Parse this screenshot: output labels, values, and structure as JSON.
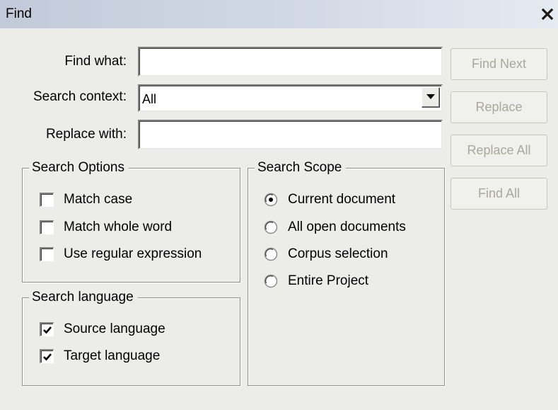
{
  "window": {
    "title": "Find",
    "close_icon": "close-icon"
  },
  "form": {
    "find_what_label": "Find what:",
    "find_what_value": "",
    "search_context_label": "Search context:",
    "search_context_value": "All",
    "replace_with_label": "Replace with:",
    "replace_with_value": ""
  },
  "buttons": {
    "find_next": "Find Next",
    "replace": "Replace",
    "replace_all": "Replace All",
    "find_all": "Find All",
    "enabled": false
  },
  "search_options": {
    "title": "Search Options",
    "items": [
      {
        "label": "Match case",
        "checked": false
      },
      {
        "label": "Match whole word",
        "checked": false
      },
      {
        "label": "Use regular expression",
        "checked": false
      }
    ]
  },
  "search_language": {
    "title": "Search language",
    "items": [
      {
        "label": "Source language",
        "checked": true
      },
      {
        "label": "Target language",
        "checked": true
      }
    ]
  },
  "search_scope": {
    "title": "Search Scope",
    "items": [
      {
        "label": "Current document",
        "selected": true
      },
      {
        "label": "All open documents",
        "selected": false
      },
      {
        "label": "Corpus selection",
        "selected": false
      },
      {
        "label": "Entire Project",
        "selected": false
      }
    ]
  },
  "colors": {
    "dialog_bg": "#ecece9",
    "title_gradient_start": "#c2cad9",
    "title_gradient_end": "#e6eaf1",
    "disabled_text": "#a8a89e"
  }
}
